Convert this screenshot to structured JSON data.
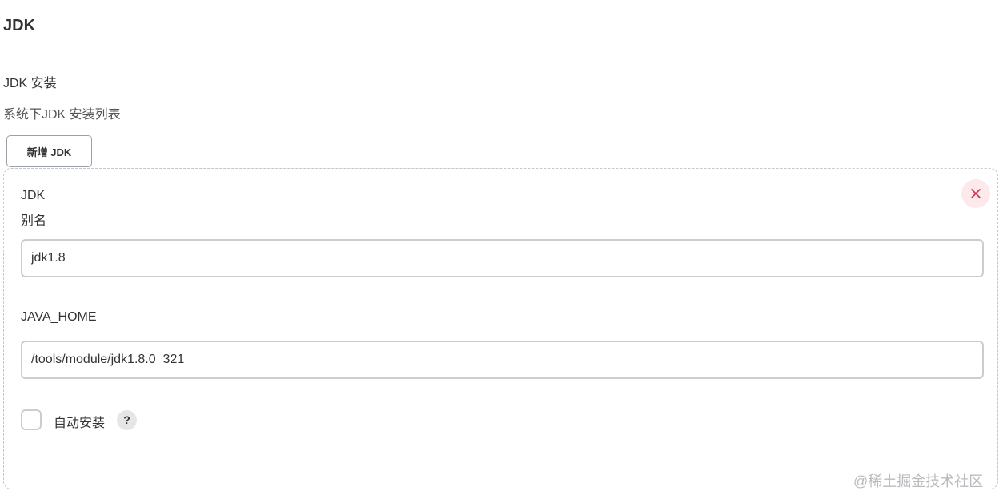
{
  "section": {
    "title": "JDK"
  },
  "installations": {
    "label": "JDK 安装",
    "description": "系统下JDK 安装列表",
    "add_button_label": "新增 JDK"
  },
  "jdk_entry": {
    "type_label": "JDK",
    "alias_label": "别名",
    "alias_value": "jdk1.8",
    "java_home_label": "JAVA_HOME",
    "java_home_value": "/tools/module/jdk1.8.0_321",
    "auto_install_label": "自动安装",
    "auto_install_checked": false,
    "help_label": "?",
    "delete_icon": "close-icon",
    "delete_color": "#d0304a"
  },
  "watermark": {
    "text": "@稀土掘金技术社区"
  },
  "colors": {
    "delete_bg": "#fde8ec",
    "border": "#c9ced3"
  }
}
